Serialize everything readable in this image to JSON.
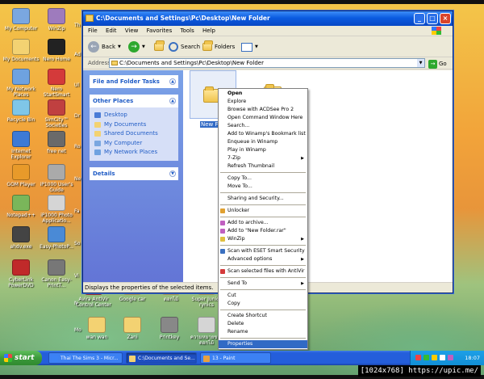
{
  "desktop": {
    "icons": [
      {
        "label": "My Computer",
        "color": "#7aa7e0"
      },
      {
        "label": "WinZip",
        "color": "#9e7bbd"
      },
      {
        "label": "My Documents",
        "color": "#f3d272"
      },
      {
        "label": "Nero Home",
        "color": "#222222"
      },
      {
        "label": "My Network Places",
        "color": "#6ea2e0"
      },
      {
        "label": "Nero StartSmart",
        "color": "#d43a3a"
      },
      {
        "label": "Recycle Bin",
        "color": "#7fc6e8"
      },
      {
        "label": "SimCity™ Societies",
        "color": "#c04040"
      },
      {
        "label": "Internet Explorer",
        "color": "#3d7ad6"
      },
      {
        "label": "free net",
        "color": "#6a6a6a"
      },
      {
        "label": "GOM Player",
        "color": "#e89a2a"
      },
      {
        "label": "iP1000 User's Guide",
        "color": "#aaaaaa"
      },
      {
        "label": "Notepad++",
        "color": "#7ab65a"
      },
      {
        "label": "iP1000 Photo Applicatio...",
        "color": "#d5d5d5"
      },
      {
        "label": "ahdv.exe",
        "color": "#444444"
      },
      {
        "label": "Easy-PhotoP...",
        "color": "#4a8ad6"
      },
      {
        "label": "CyberLink PowerDVD",
        "color": "#c02a2a"
      },
      {
        "label": "Canon Easy-PrintT...",
        "color": "#777777"
      }
    ],
    "row_icons": [
      {
        "label": "Avira AntiVir Control Center",
        "color": "#d43a3a"
      },
      {
        "label": "Google car",
        "color": "#f3d272"
      },
      {
        "label": "ดอกไม้",
        "color": "#f3d272"
      },
      {
        "label": "Super Junior rynics",
        "color": "#f3d272"
      },
      {
        "label": "wan wan",
        "color": "#f3d272"
      },
      {
        "label": "Zani",
        "color": "#f3d272"
      },
      {
        "label": "Printkey",
        "color": "#888888"
      },
      {
        "label": "ความหมายของดอกไม้",
        "color": "#d5d5d5"
      }
    ],
    "partial_labels": [
      "Th",
      "Ad",
      "Ul",
      "Dr",
      "Ro",
      "Ne",
      "Fa",
      "So",
      "Vi",
      "N",
      "Mo",
      "Ra",
      "Ap",
      "Sa"
    ]
  },
  "window": {
    "title": "C:\\Documents and Settings\\Pc\\Desktop\\New Folder",
    "menu": [
      "File",
      "Edit",
      "View",
      "Favorites",
      "Tools",
      "Help"
    ],
    "toolbar": {
      "back": "Back",
      "search": "Search",
      "folders": "Folders"
    },
    "address_label": "Address",
    "address_value": "C:\\Documents and Settings\\Pc\\Desktop\\New Folder",
    "go_label": "Go",
    "panels": {
      "tasks_title": "File and Folder Tasks",
      "places_title": "Other Places",
      "places": [
        {
          "label": "Desktop",
          "color": "#4a7bd6"
        },
        {
          "label": "My Documents",
          "color": "#f3d272"
        },
        {
          "label": "Shared Documents",
          "color": "#f3d272"
        },
        {
          "label": "My Computer",
          "color": "#7aa7e0"
        },
        {
          "label": "My Network Places",
          "color": "#6ea2e0"
        }
      ],
      "details_title": "Details"
    },
    "content": {
      "folder_label": "New Fold"
    },
    "status": "Displays the properties of the selected items."
  },
  "context_menu": {
    "items": [
      {
        "label": "Open",
        "bold": true
      },
      {
        "label": "Explore"
      },
      {
        "label": "Browse with ACDSee Pro 2"
      },
      {
        "label": "Open Command Window Here"
      },
      {
        "label": "Search..."
      },
      {
        "label": "Add to Winamp's Bookmark list"
      },
      {
        "label": "Enqueue in Winamp"
      },
      {
        "label": "Play in Winamp"
      },
      {
        "label": "7-Zip",
        "submenu": true
      },
      {
        "label": "Refresh Thumbnail"
      },
      {
        "sep": true
      },
      {
        "label": "Copy To..."
      },
      {
        "label": "Move To..."
      },
      {
        "sep": true
      },
      {
        "label": "Sharing and Security..."
      },
      {
        "sep": true
      },
      {
        "label": "Unlocker",
        "icon": "#e0a030"
      },
      {
        "sep": true
      },
      {
        "label": "Add to archive...",
        "icon": "#c060c0"
      },
      {
        "label": "Add to \"New Folder.rar\"",
        "icon": "#c060c0"
      },
      {
        "label": "WinZip",
        "icon": "#e0c040",
        "submenu": true
      },
      {
        "sep": true
      },
      {
        "label": "Scan with ESET Smart Security",
        "icon": "#3a70c0"
      },
      {
        "label": "Advanced options",
        "submenu": true
      },
      {
        "sep": true
      },
      {
        "label": "Scan selected files with AntiVir",
        "icon": "#d43a3a"
      },
      {
        "sep": true
      },
      {
        "label": "Send To",
        "submenu": true
      },
      {
        "sep": true
      },
      {
        "label": "Cut"
      },
      {
        "label": "Copy"
      },
      {
        "sep": true
      },
      {
        "label": "Create Shortcut"
      },
      {
        "label": "Delete"
      },
      {
        "label": "Rename"
      },
      {
        "sep": true
      },
      {
        "label": "Properties",
        "highlighted": true
      }
    ]
  },
  "taskbar": {
    "start_label": "start",
    "tasks": [
      {
        "label": "Thai The Sims 3 - Micr...",
        "color": "#3b82f6"
      },
      {
        "label": "C:\\Documents and Se...",
        "color": "#f3d272",
        "active": true
      },
      {
        "label": "13 - Paint",
        "color": "#e8a040"
      }
    ],
    "time": "18:07"
  },
  "watermark": "[1024x768] https://upic.me/"
}
